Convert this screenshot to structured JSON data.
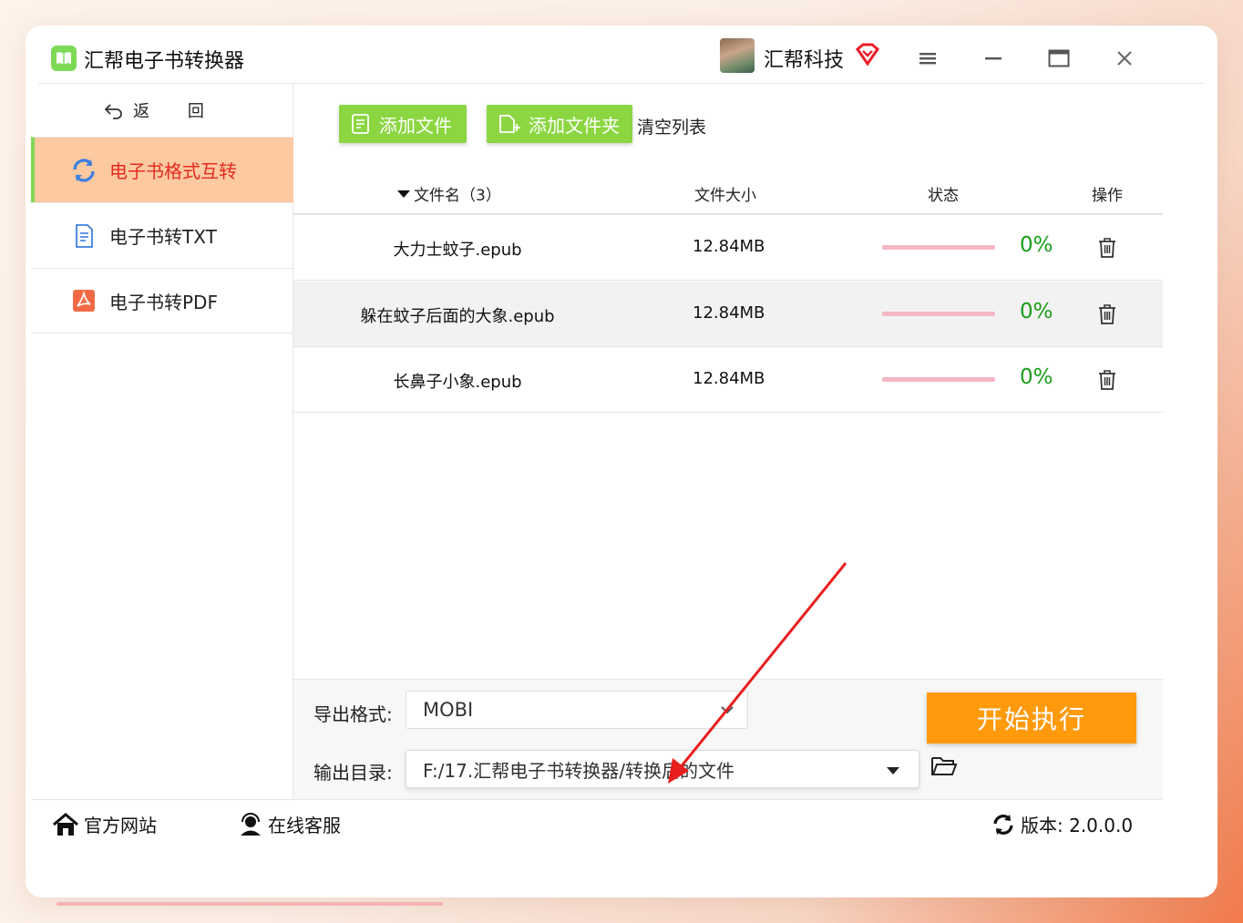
{
  "app": {
    "title": "汇帮电子书转换器",
    "user_name": "汇帮科技"
  },
  "sidebar": {
    "back_label": "返 回",
    "items": [
      {
        "label": "电子书格式互转",
        "active": true
      },
      {
        "label": "电子书转TXT",
        "active": false
      },
      {
        "label": "电子书转PDF",
        "active": false
      }
    ]
  },
  "toolbar": {
    "add_file": "添加文件",
    "add_folder": "添加文件夹",
    "clear_list": "清空列表"
  },
  "table": {
    "col_name": "文件名（3）",
    "col_size": "文件大小",
    "col_status": "状态",
    "col_action": "操作",
    "rows": [
      {
        "name": "大力士蚊子.epub",
        "size": "12.84MB",
        "progress": "0%"
      },
      {
        "name": "躲在蚊子后面的大象.epub",
        "size": "12.84MB",
        "progress": "0%"
      },
      {
        "name": "长鼻子小象.epub",
        "size": "12.84MB",
        "progress": "0%"
      }
    ]
  },
  "output": {
    "format_label": "导出格式:",
    "format_value": "MOBI",
    "dir_label": "输出目录:",
    "dir_value": "F:/17.汇帮电子书转换器/转换后的文件",
    "start_label": "开始执行"
  },
  "footer": {
    "website": "官方网站",
    "support": "在线客服",
    "version_label": "版本: 2.0.0.0"
  },
  "colors": {
    "accent_green": "#8bd641",
    "active_bg": "#fdc9a1",
    "active_text": "#e42a1e",
    "start_orange": "#ff9a0d",
    "percent_green": "#1a9c1a"
  }
}
